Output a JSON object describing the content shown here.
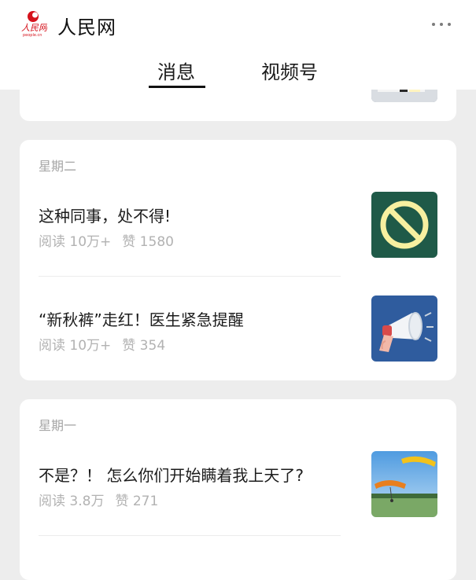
{
  "header": {
    "logo_title": "人民网",
    "logo_subtitle": "people.cn",
    "title": "人民网",
    "more_icon": "more-dots-icon"
  },
  "tabs": [
    {
      "label": "消息",
      "active": true
    },
    {
      "label": "视频号",
      "active": false
    }
  ],
  "groups": [
    {
      "day": "星期二",
      "articles": [
        {
          "title": "这种同事，处不得!",
          "reads": "阅读 10万+",
          "likes": "赞 1580",
          "thumb_icon": "prohibited-sign-icon"
        },
        {
          "title": "“新秋裤”走红！医生紧急提醒",
          "reads": "阅读 10万+",
          "likes": "赞 354",
          "thumb_icon": "megaphone-icon"
        }
      ]
    },
    {
      "day": "星期一",
      "articles": [
        {
          "title": "不是？！ 怎么你们开始瞒着我上天了?",
          "reads": "阅读 3.8万",
          "likes": "赞 271",
          "thumb_icon": "paraglider-photo"
        }
      ]
    }
  ],
  "colors": {
    "background": "#ededed",
    "card": "#ffffff",
    "meta_text": "#b2b2b2",
    "thumb_prohibited_bg": "#1f5a48",
    "thumb_prohibited_sign": "#f7f0a0",
    "thumb_megaphone_bg": "#2f5c9e"
  }
}
